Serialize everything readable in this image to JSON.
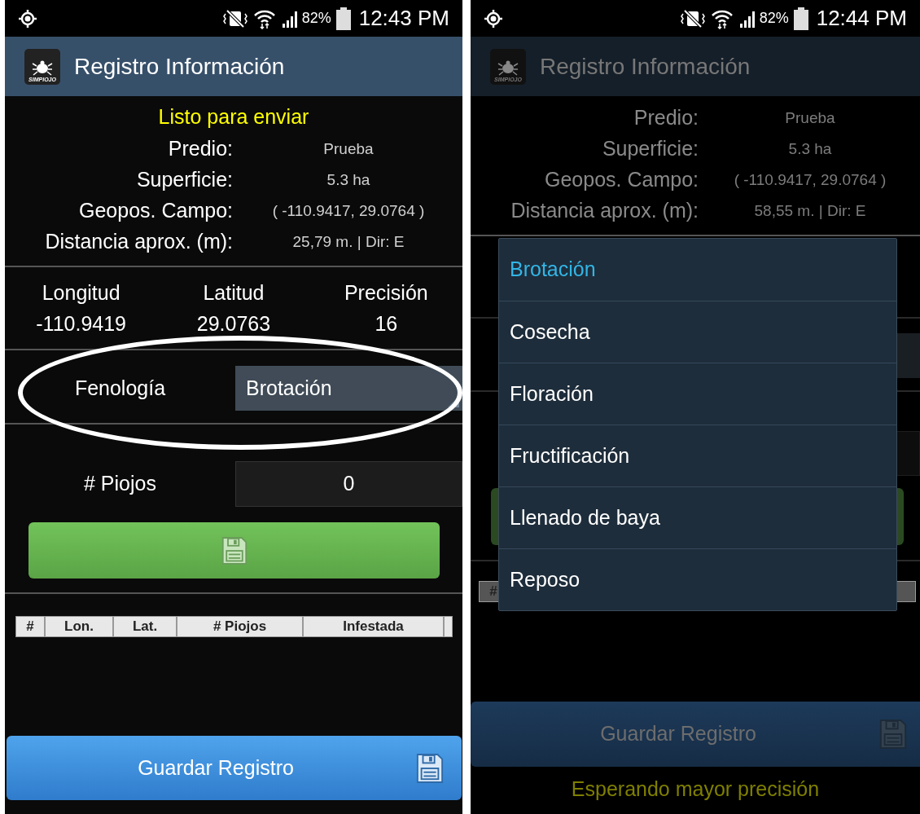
{
  "screens": [
    {
      "status_bar": {
        "battery": "82%",
        "time": "12:43 PM"
      },
      "app_bar": {
        "logo_text": "SIMPIOJO",
        "title": "Registro Información"
      },
      "status_message": "Listo para enviar",
      "info_rows": [
        {
          "label": "Predio:",
          "value": "Prueba"
        },
        {
          "label": "Superficie:",
          "value": "5.3 ha"
        },
        {
          "label": "Geopos. Campo:",
          "value": "( -110.9417, 29.0764 )"
        },
        {
          "label": "Distancia aprox. (m):",
          "value": "25,79 m. | Dir: E"
        }
      ],
      "gps": [
        {
          "label": "Longitud",
          "value": "-110.9419"
        },
        {
          "label": "Latitud",
          "value": "29.0763"
        },
        {
          "label": "Precisión",
          "value": "16"
        }
      ],
      "fenologia": {
        "label": "Fenología",
        "value": "Brotación"
      },
      "piojos": {
        "label": "# Piojos",
        "value": "0"
      },
      "table": {
        "columns": [
          "#",
          "Lon.",
          "Lat.",
          "# Piojos",
          "Infestada"
        ]
      },
      "save_button": {
        "label": "Guardar Registro"
      }
    },
    {
      "status_bar": {
        "battery": "82%",
        "time": "12:44 PM"
      },
      "app_bar": {
        "logo_text": "SIMPIOJO",
        "title": "Registro Información"
      },
      "info_rows": [
        {
          "label": "Predio:",
          "value": "Prueba"
        },
        {
          "label": "Superficie:",
          "value": "5.3 ha"
        },
        {
          "label": "Geopos. Campo:",
          "value": "( -110.9417, 29.0764 )"
        },
        {
          "label": "Distancia aprox. (m):",
          "value": "58,55 m. | Dir: E"
        }
      ],
      "dialog": {
        "options": [
          {
            "label": "Brotación",
            "selected": true
          },
          {
            "label": "Cosecha",
            "selected": false
          },
          {
            "label": "Floración",
            "selected": false
          },
          {
            "label": "Fructificación",
            "selected": false
          },
          {
            "label": "Llenado de baya",
            "selected": false
          },
          {
            "label": "Reposo",
            "selected": false
          }
        ]
      },
      "table": {
        "columns": [
          "#"
        ]
      },
      "save_button": {
        "label": "Guardar Registro"
      },
      "footer_message": "Esperando mayor precisión"
    }
  ]
}
